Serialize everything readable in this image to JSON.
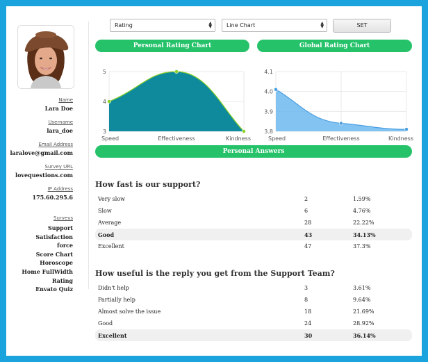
{
  "profile": {
    "name_label": "Name",
    "name": "Lara Doe",
    "username_label": "Username",
    "username": "lara_doe",
    "email_label": "Email Address",
    "email": "laralove@gmail.com",
    "survey_url_label": "Survey URL",
    "survey_url": "lovequestions.com",
    "ip_label": "IP Address",
    "ip": "175.60.295.6",
    "surveys_label": "Surveys",
    "surveys": [
      "Support Satisfaction",
      "force",
      "Score Chart",
      "Horoscope",
      "Home FullWidth",
      "Rating",
      "Envato Quiz"
    ]
  },
  "controls": {
    "metric_select": "Rating",
    "chart_type_select": "Line Chart",
    "set_button": "SET"
  },
  "headers": {
    "personal_chart": "Personal Rating Chart",
    "global_chart": "Global Rating Chart",
    "answers": "Personal Answers"
  },
  "chart_data": [
    {
      "type": "area",
      "title": "Personal Rating Chart",
      "categories": [
        "Speed",
        "Effectiveness",
        "Kindness"
      ],
      "values": [
        4,
        5,
        3
      ],
      "ylim": [
        3,
        5
      ],
      "yticks": [
        "3",
        "4",
        "5"
      ],
      "color": "#0e8a9c",
      "line_color": "#8bd12a",
      "grid": true
    },
    {
      "type": "area",
      "title": "Global Rating Chart",
      "categories": [
        "Speed",
        "Effectiveness",
        "Kindness"
      ],
      "values": [
        4.01,
        3.84,
        3.81
      ],
      "ylim": [
        3.8,
        4.1
      ],
      "yticks": [
        "3.8",
        "3.9",
        "4.0",
        "4.1"
      ],
      "color": "#6cb8f0",
      "line_color": "#4a9fe0",
      "grid": true
    }
  ],
  "questions": [
    {
      "text": "How fast is our support?",
      "rows": [
        {
          "answer": "Very slow",
          "count": "2",
          "percent": "1.59%",
          "highlight": false
        },
        {
          "answer": "Slow",
          "count": "6",
          "percent": "4.76%",
          "highlight": false
        },
        {
          "answer": "Average",
          "count": "28",
          "percent": "22.22%",
          "highlight": false
        },
        {
          "answer": "Good",
          "count": "43",
          "percent": "34.13%",
          "highlight": true
        },
        {
          "answer": "Excellent",
          "count": "47",
          "percent": "37.3%",
          "highlight": false
        }
      ]
    },
    {
      "text": "How useful is the reply you get from the Support Team?",
      "rows": [
        {
          "answer": "Didn't help",
          "count": "3",
          "percent": "3.61%",
          "highlight": false
        },
        {
          "answer": "Partially help",
          "count": "8",
          "percent": "9.64%",
          "highlight": false
        },
        {
          "answer": "Almost solve the issue",
          "count": "18",
          "percent": "21.69%",
          "highlight": false
        },
        {
          "answer": "Good",
          "count": "24",
          "percent": "28.92%",
          "highlight": false
        },
        {
          "answer": "Excellent",
          "count": "30",
          "percent": "36.14%",
          "highlight": true
        }
      ]
    }
  ]
}
